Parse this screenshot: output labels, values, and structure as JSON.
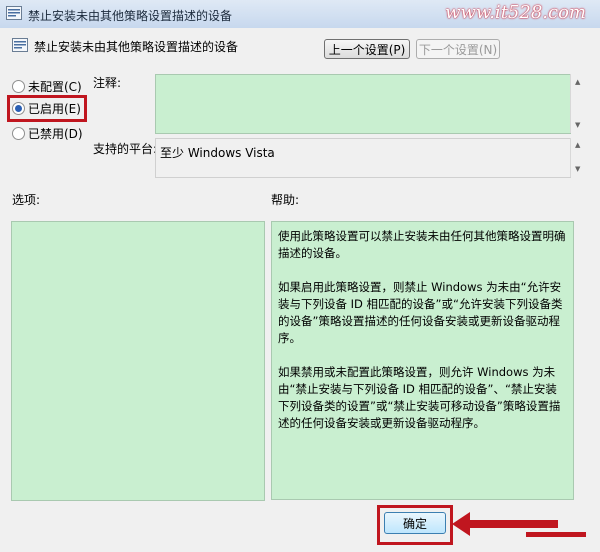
{
  "window": {
    "title": "禁止安装未由其他策略设置描述的设备",
    "watermark": "www.it528.com"
  },
  "policy": {
    "title": "禁止安装未由其他策略设置描述的设备"
  },
  "nav": {
    "prev_label": "上一个设置(P)",
    "next_label": "下一个设置(N)"
  },
  "state": {
    "options": [
      {
        "label": "未配置(C)",
        "selected": false
      },
      {
        "label": "已启用(E)",
        "selected": true
      },
      {
        "label": "已禁用(D)",
        "selected": false
      }
    ]
  },
  "labels": {
    "comment": "注释:",
    "platform": "支持的平台:",
    "options": "选项:",
    "help": "帮助:"
  },
  "platform": {
    "value": "至少 Windows Vista"
  },
  "help": {
    "paragraphs": [
      "使用此策略设置可以禁止安装未由任何其他策略设置明确描述的设备。",
      "如果启用此策略设置，则禁止 Windows 为未由“允许安装与下列设备 ID 相匹配的设备”或“允许安装下列设备类的设备”策略设置描述的任何设备安装或更新设备驱动程序。",
      "如果禁用或未配置此策略设置，则允许 Windows 为未由“禁止安装与下列设备 ID 相匹配的设备”、“禁止安装下列设备类的设置”或“禁止安装可移动设备”策略设置描述的任何设备安装或更新设备驱动程序。"
    ]
  },
  "footer": {
    "ok_label": "确定"
  },
  "colors": {
    "highlight": "#c0161f",
    "panel_green": "#c9efd0"
  }
}
